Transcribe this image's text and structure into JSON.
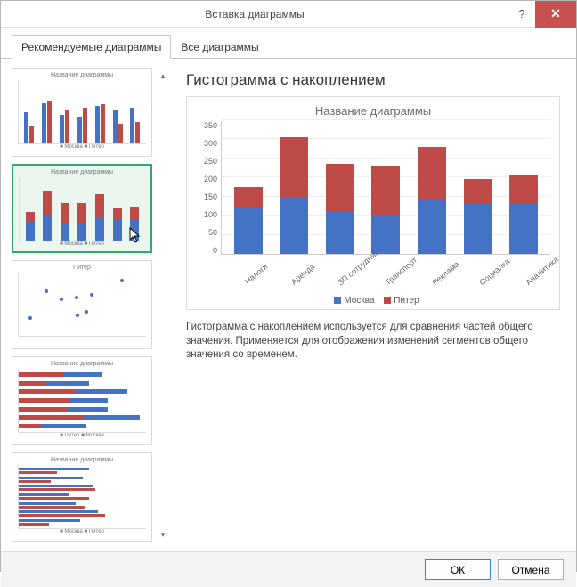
{
  "window": {
    "title": "Вставка диаграммы",
    "help_label": "?",
    "close_label": "✕"
  },
  "tabs": [
    {
      "label": "Рекомендуемые диаграммы",
      "active": true
    },
    {
      "label": "Все диаграммы",
      "active": false
    }
  ],
  "thumbnails": [
    {
      "title": "Название диаграммы",
      "type": "clustered-column",
      "legend": "■ Москва ■ Питер"
    },
    {
      "title": "Название диаграммы",
      "type": "stacked-column",
      "legend": "■ Москва ■ Питер",
      "selected": true
    },
    {
      "title": "Питер",
      "type": "scatter",
      "legend": ""
    },
    {
      "title": "Название диаграммы",
      "type": "stacked-bar",
      "legend": "■ Питер ■ Москва"
    },
    {
      "title": "Название диаграммы",
      "type": "clustered-bar",
      "legend": "■ Москва ■ Питер"
    }
  ],
  "preview": {
    "heading": "Гистограмма с накоплением",
    "chart_title": "Название диаграммы",
    "legend_a": "Москва",
    "legend_b": "Питер",
    "description": "Гистограмма с накоплением используется для сравнения частей общего значения. Применяется для отображения изменений сегментов общего значения со временем."
  },
  "chart_data": {
    "type": "bar",
    "stacked": true,
    "title": "Название диаграммы",
    "xlabel": "",
    "ylabel": "",
    "ylim": [
      0,
      350
    ],
    "y_ticks": [
      0,
      50,
      100,
      150,
      200,
      250,
      300,
      350
    ],
    "categories": [
      "Налоги",
      "Аренда",
      "ЗП сотрудников",
      "Транспорт",
      "Реклама",
      "Социалка",
      "Аналитика"
    ],
    "series": [
      {
        "name": "Москва",
        "color": "#4472c4",
        "values": [
          120,
          150,
          110,
          100,
          140,
          130,
          130
        ]
      },
      {
        "name": "Питер",
        "color": "#be4b48",
        "values": [
          55,
          155,
          125,
          130,
          140,
          65,
          75
        ]
      }
    ]
  },
  "colors": {
    "series_a": "#4472c4",
    "series_b": "#be4b48",
    "accent_selected": "#2faa6c",
    "close_bg": "#c75050"
  },
  "buttons": {
    "ok": "ОК",
    "cancel": "Отмена"
  }
}
